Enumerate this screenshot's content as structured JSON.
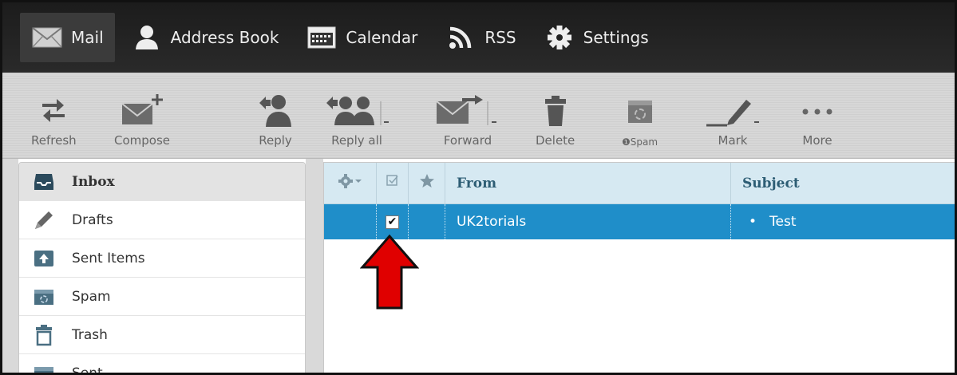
{
  "nav": {
    "items": [
      {
        "label": "Mail",
        "icon": "mail-icon",
        "active": true
      },
      {
        "label": "Address Book",
        "icon": "person-icon"
      },
      {
        "label": "Calendar",
        "icon": "calendar-icon"
      },
      {
        "label": "RSS",
        "icon": "rss-icon"
      },
      {
        "label": "Settings",
        "icon": "gear-icon"
      }
    ]
  },
  "toolbar": {
    "refresh": "Refresh",
    "compose": "Compose",
    "reply": "Reply",
    "reply_all": "Reply all",
    "forward": "Forward",
    "delete": "Delete",
    "spam": "❶Spam",
    "mark": "Mark",
    "more": "More"
  },
  "folders": [
    {
      "label": "Inbox",
      "icon": "inbox-icon",
      "selected": true
    },
    {
      "label": "Drafts",
      "icon": "pencil-icon"
    },
    {
      "label": "Sent Items",
      "icon": "sent-items-icon"
    },
    {
      "label": "Spam",
      "icon": "spam-folder-icon"
    },
    {
      "label": "Trash",
      "icon": "trash-icon"
    },
    {
      "label": "Sent",
      "icon": "sent-folder-icon"
    }
  ],
  "message_list": {
    "columns": {
      "from": "From",
      "subject": "Subject"
    },
    "rows": [
      {
        "checked": true,
        "from": "UK2torials",
        "subject": "Test",
        "bullet": "•"
      }
    ]
  },
  "colors": {
    "nav_bg": "#1c1c1c",
    "selected_row": "#1f8ec9",
    "header_bg": "#d6e9f2",
    "arrow_red": "#e00000"
  }
}
